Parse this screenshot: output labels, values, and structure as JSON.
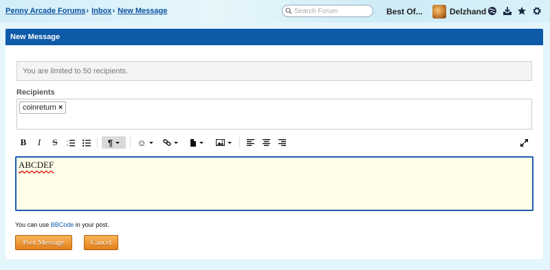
{
  "breadcrumbs": {
    "forum": "Penny Arcade Forums",
    "inbox": "Inbox",
    "current": "New Message",
    "separator": "›"
  },
  "topnav": {
    "search_placeholder": "Search Forum",
    "best_of": "Best Of...",
    "username": "Delzhand",
    "icons": [
      "globe-icon",
      "inbox-icon",
      "star-icon",
      "gear-icon"
    ]
  },
  "panel": {
    "title": "New Message",
    "notice": "You are limited to 50 recipients.",
    "recipients_label": "Recipients",
    "recipients": [
      "coinreturn"
    ],
    "remove_symbol": "×"
  },
  "toolbar": {
    "buttons": [
      "bold-icon",
      "italic-icon",
      "strikethrough-icon",
      "ordered-list-icon",
      "bullet-list-icon",
      "paragraph-format-icon",
      "emoji-icon",
      "link-icon",
      "attachment-icon",
      "image-icon",
      "align-left-icon",
      "align-center-icon",
      "align-right-icon",
      "fullscreen-icon"
    ],
    "bold_glyph": "B",
    "italic_glyph": "I",
    "strike_glyph": "S",
    "paragraph_glyph": "¶",
    "emoji_glyph": "☺"
  },
  "editor": {
    "content": "ABCDEF"
  },
  "hint": {
    "prefix": "You can use ",
    "link": "BBCode",
    "suffix": " in your post."
  },
  "actions": {
    "post": "Post Message",
    "cancel": "Cancel"
  },
  "colors": {
    "header_blue": "#0d5aa8",
    "editor_bg": "#fdfde8",
    "button_orange": "#e47f1a"
  }
}
